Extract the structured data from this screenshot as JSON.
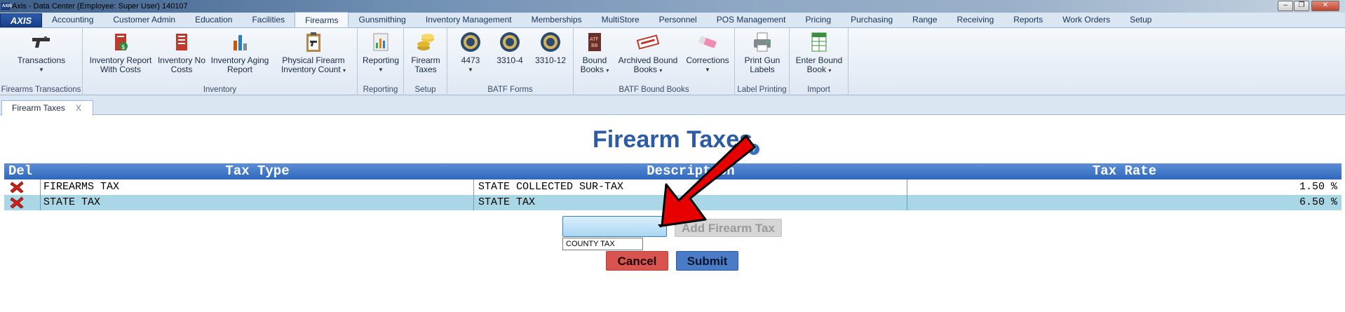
{
  "window": {
    "title": "Axis - Data Center  (Employee: Super User) 140107",
    "logo_small": "AXIS",
    "minimize": "–",
    "restore": "❐",
    "close": "✕"
  },
  "menubar": {
    "logo": "AXIS",
    "tabs": [
      "Accounting",
      "Customer Admin",
      "Education",
      "Facilities",
      "Firearms",
      "Gunsmithing",
      "Inventory Management",
      "Memberships",
      "MultiStore",
      "Personnel",
      "POS Management",
      "Pricing",
      "Purchasing",
      "Range",
      "Receiving",
      "Reports",
      "Work Orders",
      "Setup"
    ],
    "active_tab": "Firearms"
  },
  "ribbon": {
    "groups": [
      {
        "label": "Firearms Transactions",
        "buttons": [
          {
            "line1": "Transactions",
            "line2": "",
            "dropdown": true,
            "icon": "pistol-icon"
          }
        ]
      },
      {
        "label": "Inventory",
        "buttons": [
          {
            "line1": "Inventory Report",
            "line2": "With Costs",
            "dropdown": false,
            "icon": "report-costs-icon"
          },
          {
            "line1": "Inventory No",
            "line2": "Costs",
            "dropdown": false,
            "icon": "report-no-costs-icon"
          },
          {
            "line1": "Inventory Aging",
            "line2": "Report",
            "dropdown": false,
            "icon": "aging-chart-icon"
          },
          {
            "line1": "Physical Firearm",
            "line2": "Inventory Count",
            "dropdown": true,
            "icon": "clipboard-pistol-icon"
          }
        ]
      },
      {
        "label": "Reporting",
        "buttons": [
          {
            "line1": "Reporting",
            "line2": "",
            "dropdown": true,
            "icon": "bar-chart-icon"
          }
        ]
      },
      {
        "label": "Setup",
        "buttons": [
          {
            "line1": "Firearm",
            "line2": "Taxes",
            "dropdown": false,
            "icon": "coins-icon"
          }
        ]
      },
      {
        "label": "BATF Forms",
        "buttons": [
          {
            "line1": "4473",
            "line2": "",
            "dropdown": true,
            "icon": "batf-seal-icon"
          },
          {
            "line1": "3310-4",
            "line2": "",
            "dropdown": false,
            "icon": "batf-seal-icon"
          },
          {
            "line1": "3310-12",
            "line2": "",
            "dropdown": false,
            "icon": "batf-seal-icon"
          }
        ]
      },
      {
        "label": "BATF Bound Books",
        "buttons": [
          {
            "line1": "Bound",
            "line2": "Books",
            "dropdown": true,
            "icon": "atf-book-icon"
          },
          {
            "line1": "Archived Bound",
            "line2": "Books",
            "dropdown": true,
            "icon": "archived-stamp-icon"
          },
          {
            "line1": "Corrections",
            "line2": "",
            "dropdown": true,
            "icon": "eraser-icon"
          }
        ]
      },
      {
        "label": "Label Printing",
        "buttons": [
          {
            "line1": "Print Gun",
            "line2": "Labels",
            "dropdown": false,
            "icon": "printer-icon"
          }
        ]
      },
      {
        "label": "Import",
        "buttons": [
          {
            "line1": "Enter Bound",
            "line2": "Book",
            "dropdown": true,
            "icon": "spreadsheet-icon"
          }
        ]
      }
    ]
  },
  "doc_tabs": [
    {
      "label": "Firearm Taxes",
      "close": "X"
    }
  ],
  "page": {
    "title": "Firearm Taxes",
    "help": "?"
  },
  "grid": {
    "headers": {
      "del": "Del",
      "tax_type": "Tax Type",
      "description": "Description",
      "tax_rate": "Tax Rate"
    },
    "rows": [
      {
        "tax_type": "FIREARMS TAX",
        "description": "STATE COLLECTED SUR-TAX",
        "tax_rate": "1.50 %"
      },
      {
        "tax_type": "STATE TAX",
        "description": "STATE TAX",
        "tax_rate": "6.50 %"
      }
    ]
  },
  "form": {
    "select_value": "",
    "dropdown_options": [
      "COUNTY TAX"
    ],
    "add_button": "Add Firearm Tax",
    "cancel_button": "Cancel",
    "submit_button": "Submit"
  },
  "colors": {
    "title": "#2e5ba6",
    "header_bg": "#2f67bd",
    "alt_row": "#a9d7e6",
    "cancel": "#d9534f",
    "submit": "#4a7bc6",
    "annotation_arrow": "#e60000"
  }
}
